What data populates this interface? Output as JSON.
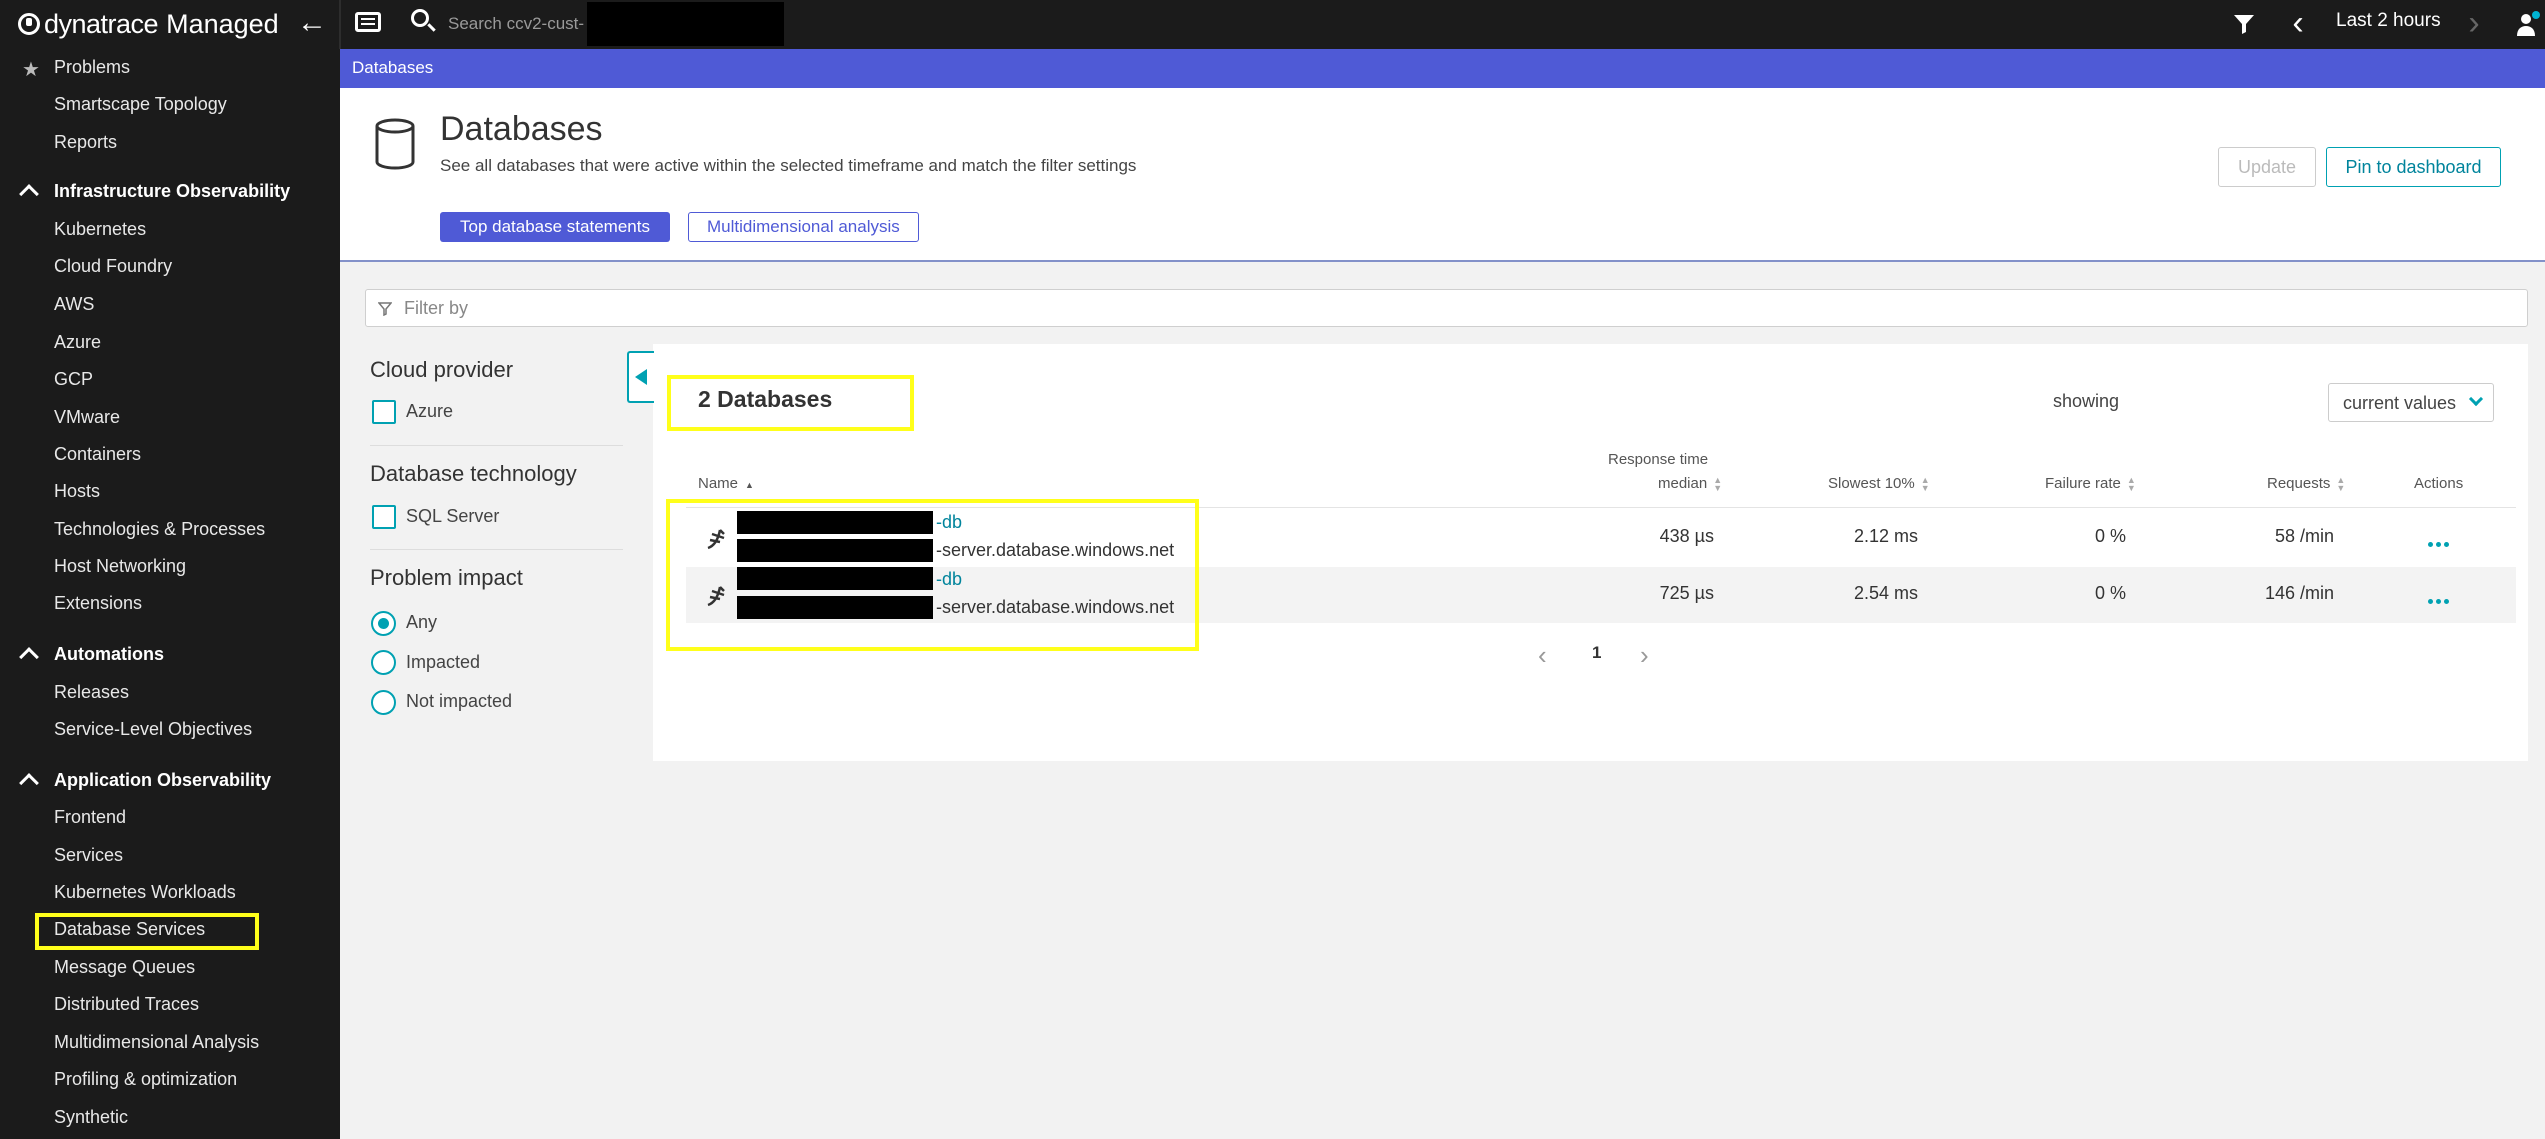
{
  "topbar": {
    "brand_main": "dynatrace",
    "brand_sub": "Managed",
    "search_placeholder": "Search ccv2-cust-",
    "timeframe": "Last 2 hours"
  },
  "sidebar": {
    "top_items": [
      "Problems",
      "Smartscape Topology",
      "Reports"
    ],
    "sections": [
      {
        "title": "Infrastructure Observability",
        "items": [
          "Kubernetes",
          "Cloud Foundry",
          "AWS",
          "Azure",
          "GCP",
          "VMware",
          "Containers",
          "Hosts",
          "Technologies & Processes",
          "Host Networking",
          "Extensions"
        ]
      },
      {
        "title": "Automations",
        "items": [
          "Releases",
          "Service-Level Objectives"
        ]
      },
      {
        "title": "Application Observability",
        "items": [
          "Frontend",
          "Services",
          "Kubernetes Workloads",
          "Database Services",
          "Message Queues",
          "Distributed Traces",
          "Multidimensional Analysis",
          "Profiling & optimization",
          "Synthetic"
        ]
      }
    ]
  },
  "breadcrumb": "Databases",
  "header": {
    "title": "Databases",
    "description": "See all databases that were active within the selected timeframe and match the filter settings",
    "btn_top_statements": "Top database statements",
    "btn_multidim": "Multidimensional analysis",
    "btn_update": "Update",
    "btn_pin": "Pin to dashboard"
  },
  "filter": {
    "placeholder": "Filter by"
  },
  "facets": {
    "cloud_provider": {
      "title": "Cloud provider",
      "options": [
        "Azure"
      ]
    },
    "db_technology": {
      "title": "Database technology",
      "options": [
        "SQL Server"
      ]
    },
    "problem_impact": {
      "title": "Problem impact",
      "options": [
        "Any",
        "Impacted",
        "Not impacted"
      ],
      "selected": "Any"
    }
  },
  "table": {
    "count_title": "2 Databases",
    "showing_label": "showing",
    "showing_value": "current values",
    "headers": {
      "name": "Name",
      "resp_line1": "Response time",
      "resp_line2": "median",
      "slowest": "Slowest 10%",
      "failure": "Failure rate",
      "requests": "Requests",
      "actions": "Actions"
    },
    "rows": [
      {
        "db_suffix": "-db",
        "host_suffix": "-server.database.windows.net",
        "response_median": "438 µs",
        "slowest_10": "2.12 ms",
        "failure_rate": "0 %",
        "requests": "58 /min"
      },
      {
        "db_suffix": "-db",
        "host_suffix": "-server.database.windows.net",
        "response_median": "725 µs",
        "slowest_10": "2.54 ms",
        "failure_rate": "0 %",
        "requests": "146 /min"
      }
    ],
    "page": "1"
  },
  "colors": {
    "accent": "#4f5ad6",
    "teal": "#00a1b2",
    "highlight": "#ffff1a",
    "topbar": "#1b1b1b"
  }
}
